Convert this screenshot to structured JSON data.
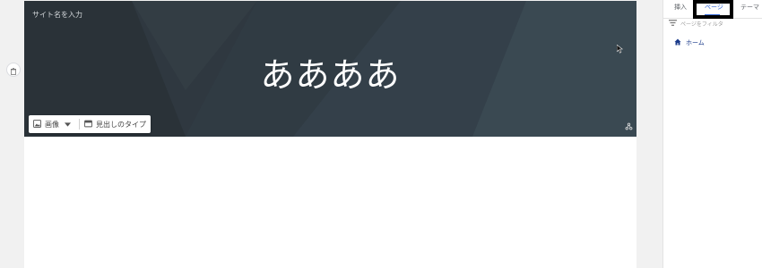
{
  "header": {
    "site_name_placeholder": "サイト名を入力",
    "title": "ああああ",
    "image_button_label": "画像",
    "heading_type_label": "見出しのタイプ"
  },
  "panel": {
    "tabs": [
      {
        "label": "挿入",
        "active": false
      },
      {
        "label": "ページ",
        "active": true
      },
      {
        "label": "テーマ",
        "active": false
      }
    ],
    "filter_placeholder": "ページをフィルタ",
    "pages": [
      {
        "label": "ホーム",
        "icon": "home-icon"
      }
    ]
  },
  "icons": {
    "delete": "trash-icon",
    "image": "image-icon",
    "dropdown": "caret-down-icon",
    "heading": "heading-type-icon",
    "filter": "filter-icon",
    "attribution": "attribution-icon",
    "cursor": "mouse-cursor-icon"
  },
  "colors": {
    "accent": "#3367d6",
    "header_bg": "#303a41",
    "page_link": "#1a3a8a"
  }
}
